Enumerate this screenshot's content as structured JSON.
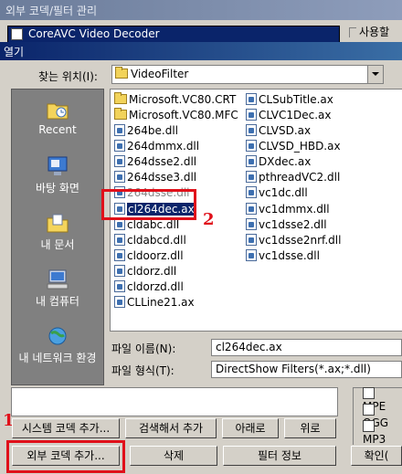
{
  "window": {
    "title": "외부 코덱/필터 관리"
  },
  "top_combo": {
    "text": "CoreAVC Video Decoder"
  },
  "usage_label": "사용할 코",
  "dialog": {
    "title": "열기",
    "look_in_label": "찾는 위치(I):",
    "look_in_value": "VideoFilter",
    "places": [
      {
        "label": "Recent",
        "icon": "recent-folder-icon"
      },
      {
        "label": "바탕 화면",
        "icon": "desktop-icon"
      },
      {
        "label": "내 문서",
        "icon": "my-documents-icon"
      },
      {
        "label": "내 컴퓨터",
        "icon": "my-computer-icon"
      },
      {
        "label": "내 네트워크 환경",
        "icon": "network-icon"
      }
    ],
    "files_col1": [
      {
        "name": "Microsoft.VC80.CRT",
        "type": "folder"
      },
      {
        "name": "Microsoft.VC80.MFC",
        "type": "folder"
      },
      {
        "name": "264be.dll",
        "type": "file"
      },
      {
        "name": "264dmmx.dll",
        "type": "file"
      },
      {
        "name": "264dsse2.dll",
        "type": "file"
      },
      {
        "name": "264dsse3.dll",
        "type": "file"
      },
      {
        "name": "264dsse.dll",
        "type": "file"
      },
      {
        "name": "cl264dec.ax",
        "type": "file"
      },
      {
        "name": "cldabc.dll",
        "type": "file"
      },
      {
        "name": "cldabcd.dll",
        "type": "file"
      },
      {
        "name": "cldoorz.dll",
        "type": "file"
      },
      {
        "name": "cldorz.dll",
        "type": "file"
      },
      {
        "name": "cldorzd.dll",
        "type": "file"
      },
      {
        "name": "CLLine21.ax",
        "type": "file"
      }
    ],
    "files_col2": [
      {
        "name": "CLSubTitle.ax",
        "type": "file"
      },
      {
        "name": "CLVC1Dec.ax",
        "type": "file"
      },
      {
        "name": "CLVSD.ax",
        "type": "file"
      },
      {
        "name": "CLVSD_HBD.ax",
        "type": "file"
      },
      {
        "name": "DXdec.ax",
        "type": "file"
      },
      {
        "name": "pthreadVC2.dll",
        "type": "file"
      },
      {
        "name": "vc1dc.dll",
        "type": "file"
      },
      {
        "name": "vc1dmmx.dll",
        "type": "file"
      },
      {
        "name": "vc1dsse2.dll",
        "type": "file"
      },
      {
        "name": "vc1dsse2nrf.dll",
        "type": "file"
      },
      {
        "name": "vc1dsse.dll",
        "type": "file"
      }
    ],
    "selected_file": "cl264dec.ax",
    "filename_label": "파일 이름(N):",
    "filename_value": "cl264dec.ax",
    "filetype_label": "파일 형식(T):",
    "filetype_value": "DirectShow Filters(*.ax;*.dll)"
  },
  "buttons": {
    "add_system_codec": "시스템 코덱 추가...",
    "search_add": "검색해서 추가",
    "down": "아래로",
    "up": "위로",
    "add_external_codec": "외부 코덱 추가...",
    "delete": "삭제",
    "filter_info": "필터 정보",
    "ok": "확인("
  },
  "checkboxes": [
    {
      "label": "MPE",
      "checked": false
    },
    {
      "label": "OGG",
      "checked": false
    },
    {
      "label": "MP3",
      "checked": false
    }
  ],
  "annotations": {
    "step1": "1",
    "step2": "2"
  },
  "colors": {
    "highlight": "#0a246a",
    "annotation_red": "#e0101a",
    "dialog_title": "#0a246a"
  }
}
